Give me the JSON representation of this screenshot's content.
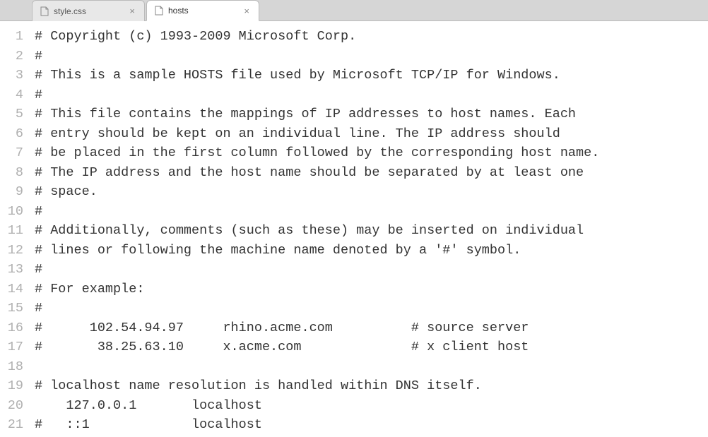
{
  "tabs": [
    {
      "label": "style.css",
      "active": false
    },
    {
      "label": "hosts",
      "active": true
    }
  ],
  "editor": {
    "lines": [
      "# Copyright (c) 1993-2009 Microsoft Corp.",
      "#",
      "# This is a sample HOSTS file used by Microsoft TCP/IP for Windows.",
      "#",
      "# This file contains the mappings of IP addresses to host names. Each",
      "# entry should be kept on an individual line. The IP address should",
      "# be placed in the first column followed by the corresponding host name.",
      "# The IP address and the host name should be separated by at least one",
      "# space.",
      "#",
      "# Additionally, comments (such as these) may be inserted on individual",
      "# lines or following the machine name denoted by a '#' symbol.",
      "#",
      "# For example:",
      "#",
      "#      102.54.94.97     rhino.acme.com          # source server",
      "#       38.25.63.10     x.acme.com              # x client host",
      "",
      "# localhost name resolution is handled within DNS itself.",
      "    127.0.0.1       localhost",
      "#   ::1             localhost"
    ],
    "start_line": 1
  }
}
